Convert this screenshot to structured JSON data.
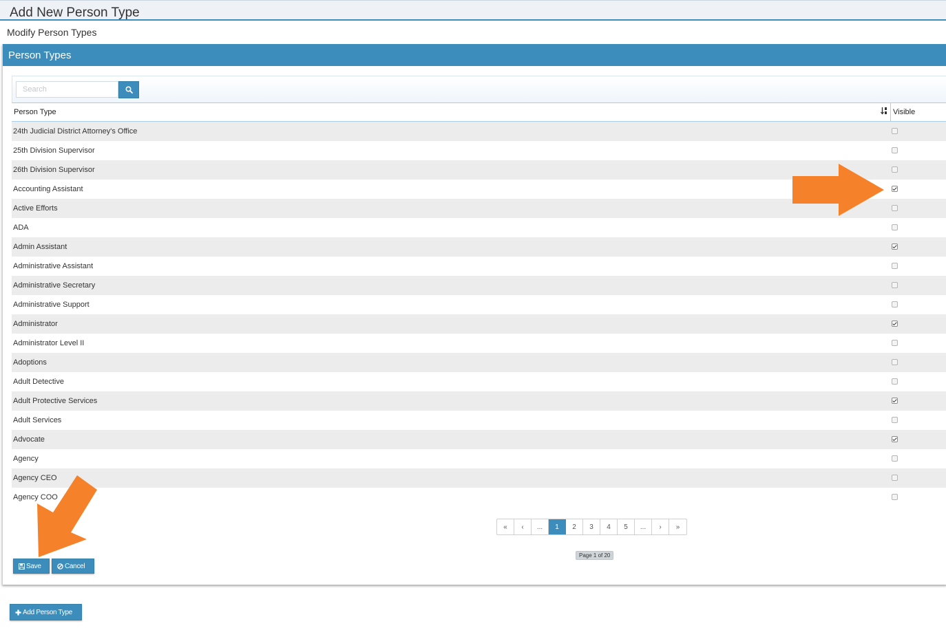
{
  "page": {
    "title": "Add New Person Type",
    "subtitle": "Modify Person Types"
  },
  "panel": {
    "heading": "Person Types"
  },
  "search": {
    "placeholder": "Search",
    "button_icon": "search-icon"
  },
  "grid": {
    "columns": {
      "person_type": "Person Type",
      "visible": "Visible",
      "sort_icon": "sort-alpha-icon"
    },
    "rows": [
      {
        "name": "24th Judicial District Attorney's Office",
        "visible": false
      },
      {
        "name": "25th Division Supervisor",
        "visible": false
      },
      {
        "name": "26th Division Supervisor",
        "visible": false
      },
      {
        "name": "Accounting Assistant",
        "visible": true
      },
      {
        "name": "Active Efforts",
        "visible": false
      },
      {
        "name": "ADA",
        "visible": false
      },
      {
        "name": "Admin Assistant",
        "visible": true
      },
      {
        "name": "Administrative Assistant",
        "visible": false
      },
      {
        "name": "Administrative Secretary",
        "visible": false
      },
      {
        "name": "Administrative Support",
        "visible": false
      },
      {
        "name": "Administrator",
        "visible": true
      },
      {
        "name": "Administrator Level II",
        "visible": false
      },
      {
        "name": "Adoptions",
        "visible": false
      },
      {
        "name": "Adult Detective",
        "visible": false
      },
      {
        "name": "Adult Protective Services",
        "visible": true
      },
      {
        "name": "Adult Services",
        "visible": false
      },
      {
        "name": "Advocate",
        "visible": true
      },
      {
        "name": "Agency",
        "visible": false
      },
      {
        "name": "Agency CEO",
        "visible": false
      },
      {
        "name": "Agency COO",
        "visible": false
      }
    ]
  },
  "pagination": {
    "items": [
      "«",
      "‹",
      "...",
      "1",
      "2",
      "3",
      "4",
      "5",
      "...",
      "›",
      "»"
    ],
    "active": "1",
    "info": "Page 1 of 20"
  },
  "actions": {
    "save_label": "Save",
    "cancel_label": "Cancel",
    "add_label": "Add Person Type"
  },
  "colors": {
    "accent": "#3c8dbc",
    "annotation_arrow": "#f5822a"
  }
}
